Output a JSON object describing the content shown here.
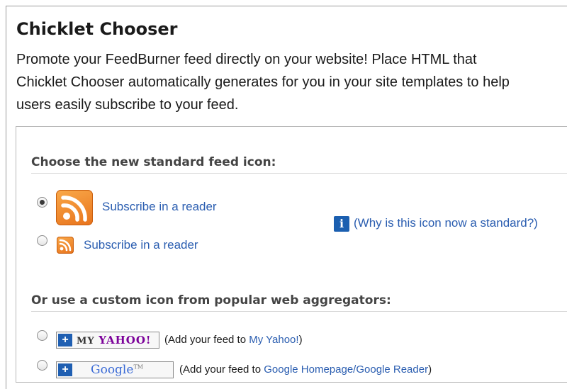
{
  "header": {
    "title": "Chicklet Chooser",
    "intro_lines": [
      "Promote your FeedBurner feed directly on your website! Place HTML that",
      "Chicklet Chooser automatically generates for you in your site templates to help",
      "users easily subscribe to your feed."
    ]
  },
  "standard_section": {
    "heading": "Choose the new standard feed icon:",
    "options": [
      {
        "label": "Subscribe in a reader",
        "icon": "feed-icon-large",
        "selected": true
      },
      {
        "label": "Subscribe in a reader",
        "icon": "feed-icon-small",
        "selected": false
      }
    ],
    "info_icon": "info-icon",
    "info_link": "(Why is this icon now a standard?)"
  },
  "custom_section": {
    "heading": "Or use a custom icon from popular web aggregators:",
    "aggregators": [
      {
        "badge_plus": "+",
        "badge_text_prefix": "MY",
        "badge_text_brand": "YAHOO!",
        "prefix": "(Add your feed to ",
        "link": "My Yahoo!",
        "suffix": ")"
      },
      {
        "badge_plus": "+",
        "badge_text": "Google",
        "badge_tm": "TM",
        "prefix": "(Add your feed to ",
        "link": "Google Homepage/Google Reader",
        "suffix": ")"
      }
    ]
  },
  "colors": {
    "link": "#2a5db0",
    "feed_orange": "#e8731c",
    "info_blue": "#1b5fb0",
    "yahoo_purple": "#7b0099"
  }
}
